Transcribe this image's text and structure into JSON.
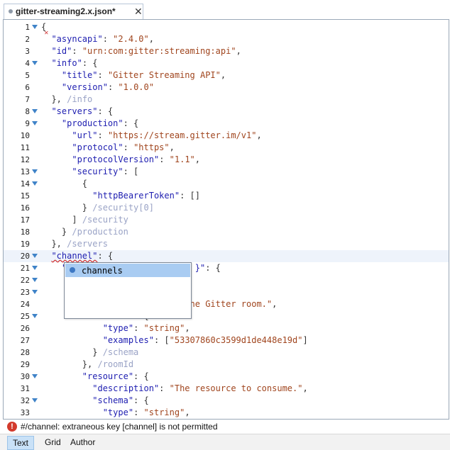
{
  "tab": {
    "title": "gitter-streaming2.x.json*",
    "close": "✕"
  },
  "editor": {
    "lines": [
      {
        "n": "1",
        "fold": true,
        "html": "<span class=\"p\">{</span>"
      },
      {
        "n": "2",
        "fold": false,
        "html": "  <span class=\"k\">\"asyncapi\"</span><span class=\"p\">: </span><span class=\"s\">\"2.4.0\"</span><span class=\"p\">,</span>"
      },
      {
        "n": "3",
        "fold": false,
        "html": "  <span class=\"k\">\"id\"</span><span class=\"p\">: </span><span class=\"s\">\"urn:com:gitter:streaming:api\"</span><span class=\"p\">,</span>"
      },
      {
        "n": "4",
        "fold": true,
        "html": "  <span class=\"k\">\"info\"</span><span class=\"p\">: {</span>"
      },
      {
        "n": "5",
        "fold": false,
        "html": "    <span class=\"k\">\"title\"</span><span class=\"p\">: </span><span class=\"s\">\"Gitter Streaming API\"</span><span class=\"p\">,</span>"
      },
      {
        "n": "6",
        "fold": false,
        "html": "    <span class=\"k\">\"version\"</span><span class=\"p\">: </span><span class=\"s\">\"1.0.0\"</span>"
      },
      {
        "n": "7",
        "fold": false,
        "html": "  <span class=\"p\">}, </span><span class=\"c\">/info</span>"
      },
      {
        "n": "8",
        "fold": true,
        "html": "  <span class=\"k\">\"servers\"</span><span class=\"p\">: {</span>"
      },
      {
        "n": "9",
        "fold": true,
        "html": "    <span class=\"k\">\"production\"</span><span class=\"p\">: {</span>"
      },
      {
        "n": "10",
        "fold": false,
        "html": "      <span class=\"k\">\"url\"</span><span class=\"p\">: </span><span class=\"s\">\"https://stream.gitter.im/v1\"</span><span class=\"p\">,</span>"
      },
      {
        "n": "11",
        "fold": false,
        "html": "      <span class=\"k\">\"protocol\"</span><span class=\"p\">: </span><span class=\"s\">\"https\"</span><span class=\"p\">,</span>"
      },
      {
        "n": "12",
        "fold": false,
        "html": "      <span class=\"k\">\"protocolVersion\"</span><span class=\"p\">: </span><span class=\"s\">\"1.1\"</span><span class=\"p\">,</span>"
      },
      {
        "n": "13",
        "fold": true,
        "html": "      <span class=\"k\">\"security\"</span><span class=\"p\">: [</span>"
      },
      {
        "n": "14",
        "fold": true,
        "html": "        <span class=\"p\">{</span>"
      },
      {
        "n": "15",
        "fold": false,
        "html": "          <span class=\"k\">\"httpBearerToken\"</span><span class=\"p\">: []</span>"
      },
      {
        "n": "16",
        "fold": false,
        "html": "        <span class=\"p\">} </span><span class=\"c\">/security[0]</span>"
      },
      {
        "n": "17",
        "fold": false,
        "html": "      <span class=\"p\">] </span><span class=\"c\">/security</span>"
      },
      {
        "n": "18",
        "fold": false,
        "html": "    <span class=\"p\">} </span><span class=\"c\">/production</span>"
      },
      {
        "n": "19",
        "fold": false,
        "html": "  <span class=\"p\">}, </span><span class=\"c\">/servers</span>"
      },
      {
        "n": "20",
        "fold": true,
        "hl": true,
        "html": "  <span class=\"k squig\">\"channel\"</span><span class=\"p\">: {</span>"
      },
      {
        "n": "21",
        "fold": true,
        "html": "    <span class=\"k\">\"</span>                         <span class=\"k\">}\"</span><span class=\"p\">: {</span>"
      },
      {
        "n": "22",
        "fold": true,
        "html": ""
      },
      {
        "n": "23",
        "fold": true,
        "html": ""
      },
      {
        "n": "24",
        "fold": false,
        "html": "                          <span class=\"s\">f the Gitter room.\"</span><span class=\"p\">,</span>"
      },
      {
        "n": "25",
        "fold": true,
        "html": "          <span class=\"k\">\"schema\"</span><span class=\"p\">: {</span>"
      },
      {
        "n": "26",
        "fold": false,
        "html": "            <span class=\"k\">\"type\"</span><span class=\"p\">: </span><span class=\"s\">\"string\"</span><span class=\"p\">,</span>"
      },
      {
        "n": "27",
        "fold": false,
        "html": "            <span class=\"k\">\"examples\"</span><span class=\"p\">: [</span><span class=\"s\">\"53307860c3599d1de448e19d\"</span><span class=\"p\">]</span>"
      },
      {
        "n": "28",
        "fold": false,
        "html": "          <span class=\"p\">} </span><span class=\"c\">/schema</span>"
      },
      {
        "n": "29",
        "fold": false,
        "html": "        <span class=\"p\">}, </span><span class=\"c\">/roomId</span>"
      },
      {
        "n": "30",
        "fold": true,
        "html": "        <span class=\"k\">\"resource\"</span><span class=\"p\">: {</span>"
      },
      {
        "n": "31",
        "fold": false,
        "html": "          <span class=\"k\">\"description\"</span><span class=\"p\">: </span><span class=\"s\">\"The resource to consume.\"</span><span class=\"p\">,</span>"
      },
      {
        "n": "32",
        "fold": true,
        "html": "          <span class=\"k\">\"schema\"</span><span class=\"p\">: {</span>"
      },
      {
        "n": "33",
        "fold": false,
        "html": "            <span class=\"k\">\"type\"</span><span class=\"p\">: </span><span class=\"s\">\"string\"</span><span class=\"p\">,</span>"
      }
    ]
  },
  "autocomplete": {
    "item": "channels"
  },
  "status": {
    "message": "#/channel: extraneous key [channel] is not permitted"
  },
  "modes": [
    "Text",
    "Grid",
    "Author"
  ],
  "colors": {
    "key": "#1d1db0",
    "string": "#a0451e",
    "comment": "#9aa3c6",
    "error": "#d33a2c",
    "selection": "#a9ccf2"
  }
}
